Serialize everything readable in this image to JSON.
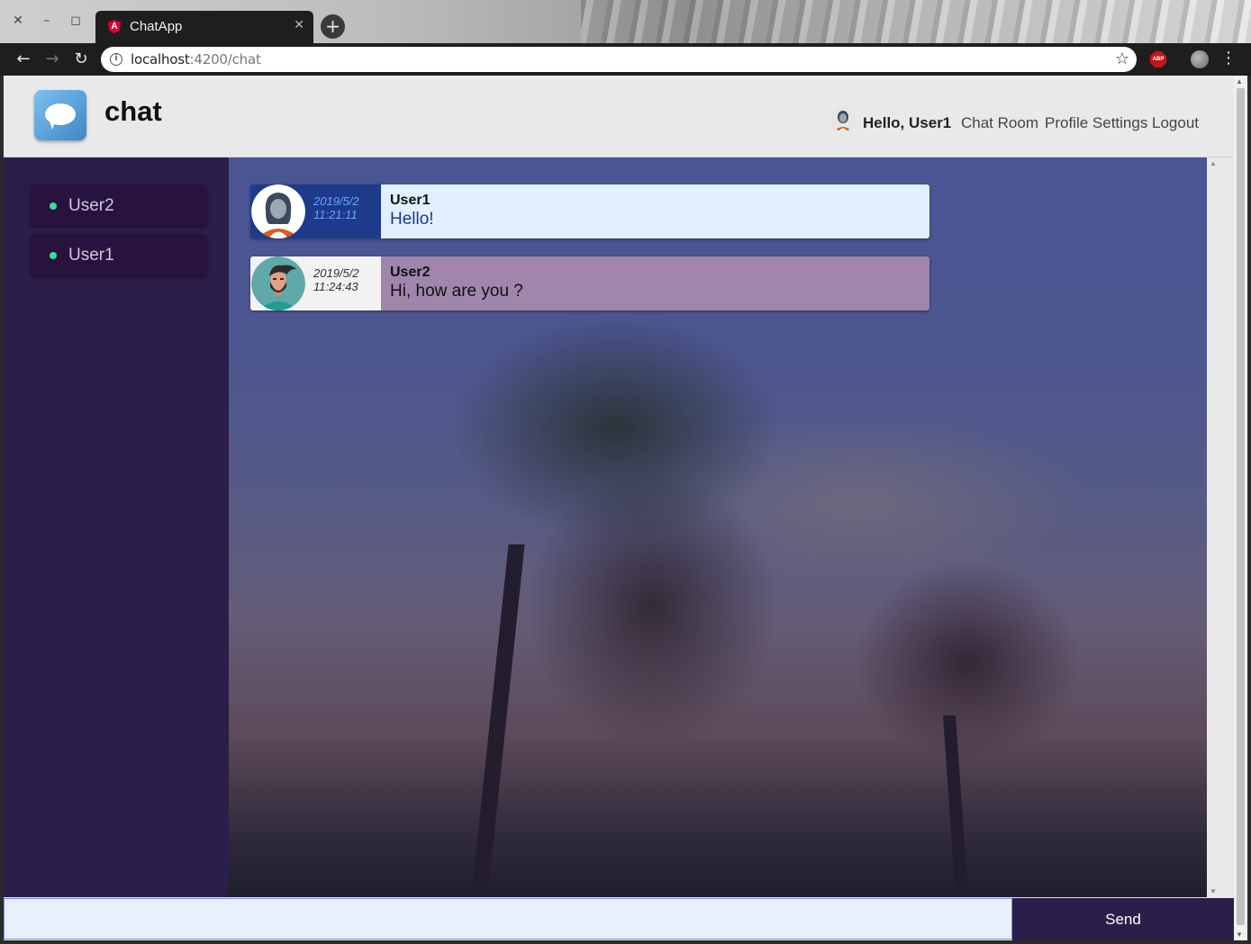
{
  "browser": {
    "tab_title": "ChatApp",
    "tab_icon_letter": "A",
    "url_host": "localhost",
    "url_path": ":4200/chat",
    "window_controls": {
      "close": "✕",
      "minimize": "–",
      "maximize": "◻"
    },
    "new_tab": "+",
    "tab_close": "✕",
    "back": "←",
    "forward": "→",
    "reload": "↻",
    "info": "i",
    "star": "☆",
    "menu": "⋮",
    "extension_label": "ABP"
  },
  "app": {
    "brand": "chat",
    "greeting": "Hello, User1",
    "nav": [
      "Chat Room",
      "Profile Settings",
      "Logout"
    ]
  },
  "sidebar": {
    "users": [
      {
        "name": "User2",
        "status": "online"
      },
      {
        "name": "User1",
        "status": "online"
      }
    ]
  },
  "messages": [
    {
      "sender": "User1",
      "date": "2019/5/2",
      "time": "11:21:11",
      "text": "Hello!",
      "own": true,
      "avatar": "woman-avatar-icon"
    },
    {
      "sender": "User2",
      "date": "2019/5/2",
      "time": "11:24:43",
      "text": "Hi, how are you ?",
      "own": false,
      "avatar": "bearded-man-avatar-icon"
    }
  ],
  "composer": {
    "placeholder": "",
    "value": "",
    "send_label": "Send"
  },
  "colors": {
    "sidebar_bg": "#2c1e4a",
    "online_dot": "#3ddc97",
    "own_meta_bg": "#1e3a8a",
    "own_body_bg": "#e1efff",
    "other_body_bg": "#a086ab",
    "send_bg": "#2c1e4a"
  }
}
